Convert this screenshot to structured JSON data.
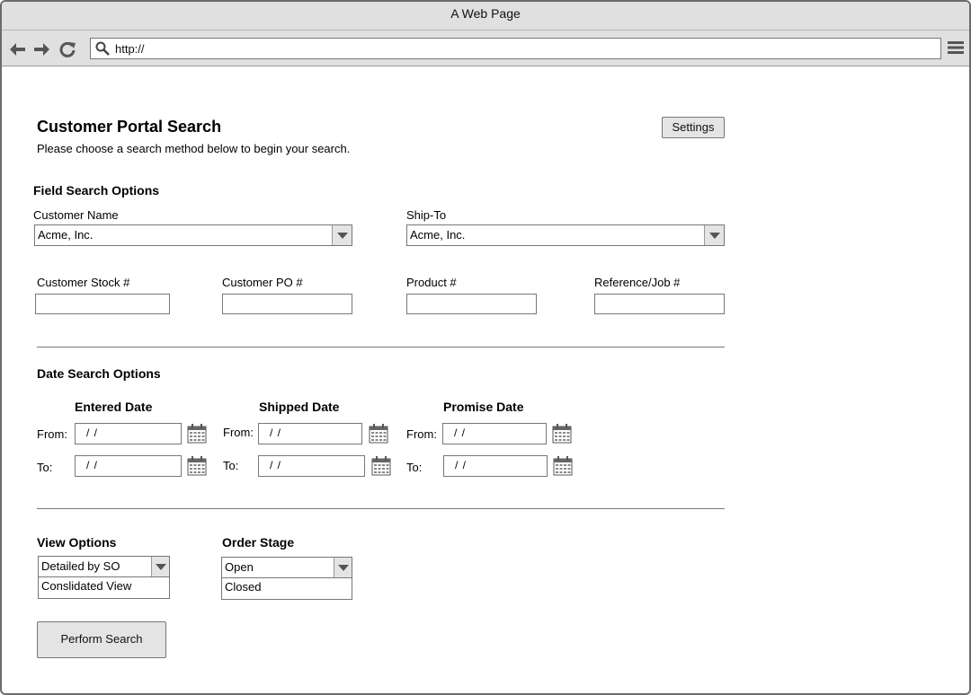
{
  "browser": {
    "window_title": "A Web Page",
    "address": "http://"
  },
  "page": {
    "title": "Customer Portal Search",
    "subtitle": "Please choose a search method below to begin your search.",
    "settings_label": "Settings"
  },
  "field_search": {
    "heading": "Field Search Options",
    "customer_name": {
      "label": "Customer Name",
      "value": "Acme, Inc."
    },
    "ship_to": {
      "label": "Ship-To",
      "value": "Acme, Inc."
    },
    "customer_stock": {
      "label": "Customer Stock #",
      "value": ""
    },
    "customer_po": {
      "label": "Customer PO #",
      "value": ""
    },
    "product": {
      "label": "Product #",
      "value": ""
    },
    "reference_job": {
      "label": "Reference/Job #",
      "value": ""
    }
  },
  "date_search": {
    "heading": "Date Search Options",
    "from_label": "From:",
    "to_label": "To:",
    "placeholder": "/ /",
    "groups": [
      {
        "title": "Entered Date",
        "from": "/ /",
        "to": "/ /"
      },
      {
        "title": "Shipped Date",
        "from": "/ /",
        "to": "/ /"
      },
      {
        "title": "Promise Date",
        "from": "/ /",
        "to": "/ /"
      }
    ]
  },
  "view_options": {
    "heading": "View Options",
    "selected": "Detailed by SO",
    "other_option": "Conslidated View"
  },
  "order_stage": {
    "heading": "Order Stage",
    "selected": "Open",
    "other_option": "Closed"
  },
  "actions": {
    "search_label": "Perform Search"
  }
}
